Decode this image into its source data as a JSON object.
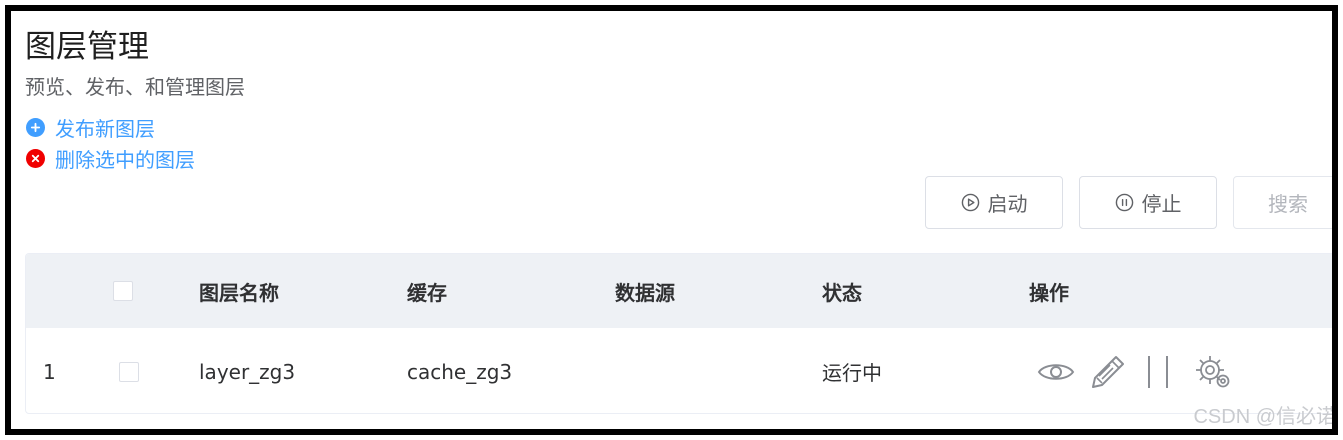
{
  "page": {
    "title": "图层管理",
    "subtitle": "预览、发布、和管理图层"
  },
  "actions": {
    "publish_label": "发布新图层",
    "delete_label": "删除选中的图层"
  },
  "toolbar": {
    "start_label": "启动",
    "stop_label": "停止",
    "search_label": "搜索"
  },
  "table": {
    "columns": {
      "name": "图层名称",
      "cache": "缓存",
      "source": "数据源",
      "status": "状态",
      "ops": "操作"
    },
    "rows": [
      {
        "index": "1",
        "name": "layer_zg3",
        "cache": "cache_zg3",
        "source": "",
        "status": "运行中"
      }
    ]
  },
  "icons": [
    "plus-circle-icon",
    "close-circle-icon",
    "play-circle-icon",
    "pause-circle-icon",
    "eye-icon",
    "edit-pencil-icon",
    "pause-bars-icon",
    "settings-gear-icon"
  ],
  "colors": {
    "accent": "#409eff",
    "danger": "#f00000",
    "header_bg": "#eef1f5",
    "icon_gray": "#8a8d93"
  },
  "watermark": "CSDN @信必诺"
}
